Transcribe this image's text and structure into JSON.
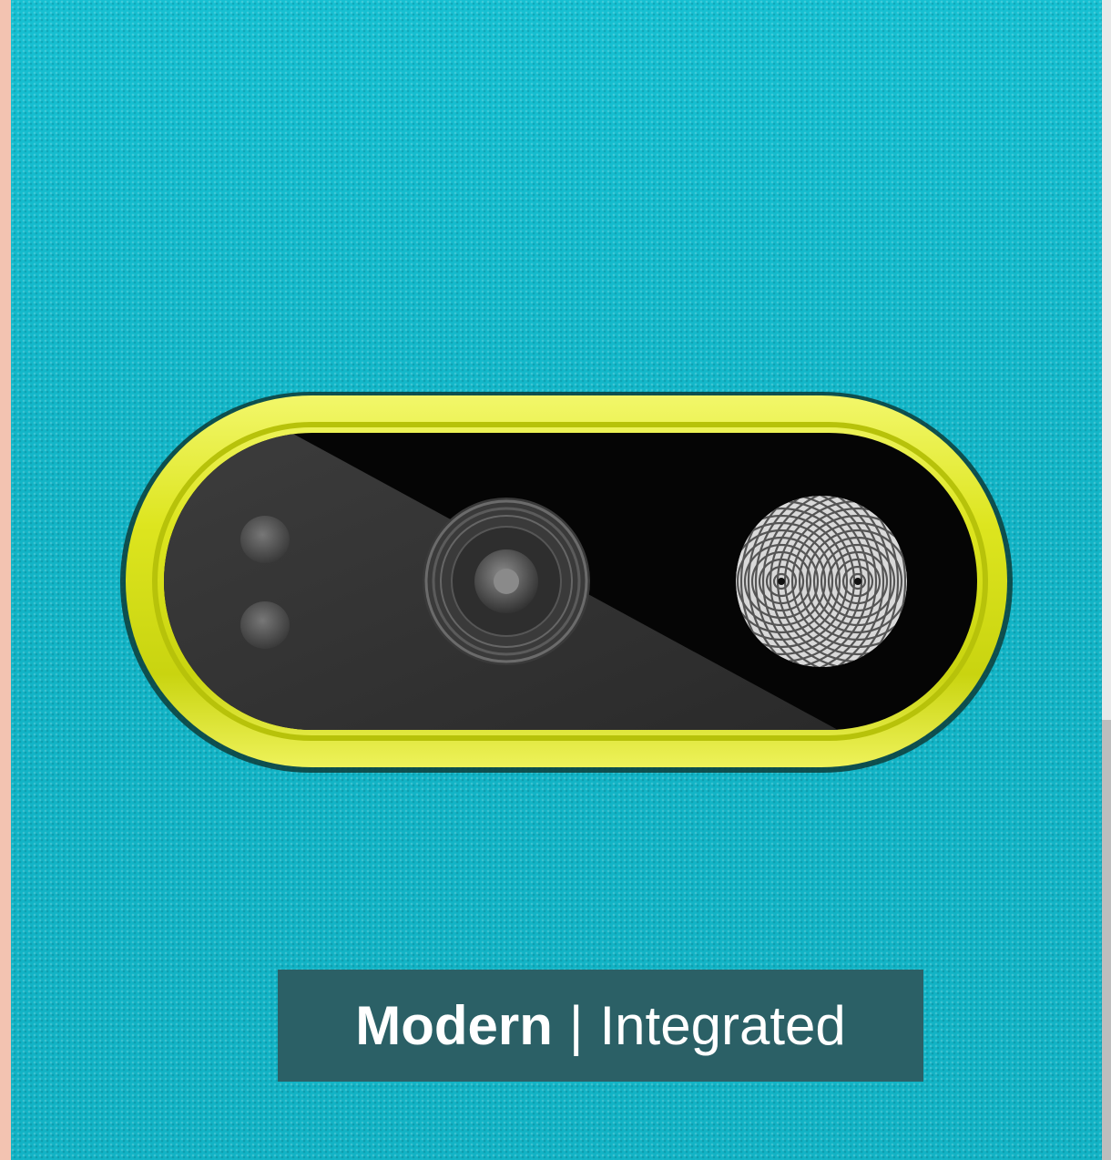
{
  "caption": {
    "primary": "Modern",
    "separator": "|",
    "secondary": "Integrated"
  },
  "colors": {
    "surface": "#14b7c9",
    "bezel": "#d8e21a",
    "lens_panel": "#050505",
    "caption_bg": "#2b6066"
  },
  "icons": {
    "flash": "dual-led-flash-icon",
    "camera": "camera-lens-icon",
    "fingerprint": "fingerprint-sensor-icon"
  }
}
